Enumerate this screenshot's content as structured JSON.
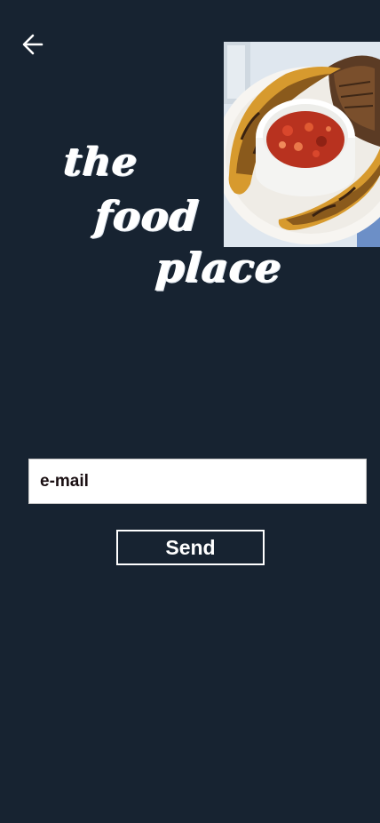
{
  "header": {
    "back_icon": "arrow-left-icon"
  },
  "logo": {
    "line1": "the",
    "line2": "food",
    "line3": "place"
  },
  "hero_image": {
    "description_icon": "food-photo"
  },
  "form": {
    "email_placeholder": "e-mail",
    "email_value": "",
    "send_label": "Send"
  },
  "colors": {
    "background": "#172331",
    "text": "#ffffff",
    "input_background": "#ffffff",
    "input_text": "#1a0f12"
  }
}
